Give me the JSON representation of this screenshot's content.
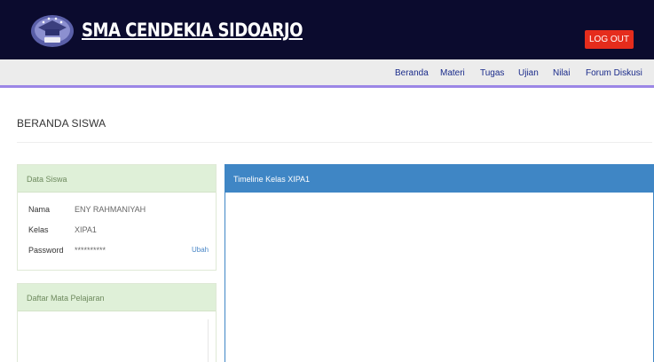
{
  "header": {
    "brand_name": "SMA CENDEKIA SIDOARJO",
    "logo_icon": "school-crest-icon",
    "logout_label": "LOG OUT",
    "colors": {
      "background": "#0b0b2e",
      "logout": "#e52c1c"
    }
  },
  "nav": {
    "items": [
      {
        "label": "Beranda"
      },
      {
        "label": "Materi"
      },
      {
        "label": "Tugas"
      },
      {
        "label": "Ujian"
      },
      {
        "label": "Nilai"
      },
      {
        "label": "Forum Diskusi"
      }
    ],
    "colors": {
      "accent": "#9b86e6",
      "text": "#1a2b8a"
    }
  },
  "page": {
    "title": "BERANDA SISWA"
  },
  "data_siswa": {
    "heading": "Data Siswa",
    "fields": [
      {
        "label": "Nama",
        "value": "ENY RAHMANIYAH"
      },
      {
        "label": "Kelas",
        "value": "XIPA1"
      },
      {
        "label": "Password",
        "value": "**********"
      }
    ],
    "edit_label": "Ubah"
  },
  "mata_pelajaran": {
    "heading": "Daftar Mata Pelajaran"
  },
  "timeline": {
    "heading": "Timeline Kelas XIPA1",
    "color": "#3f86c5"
  }
}
